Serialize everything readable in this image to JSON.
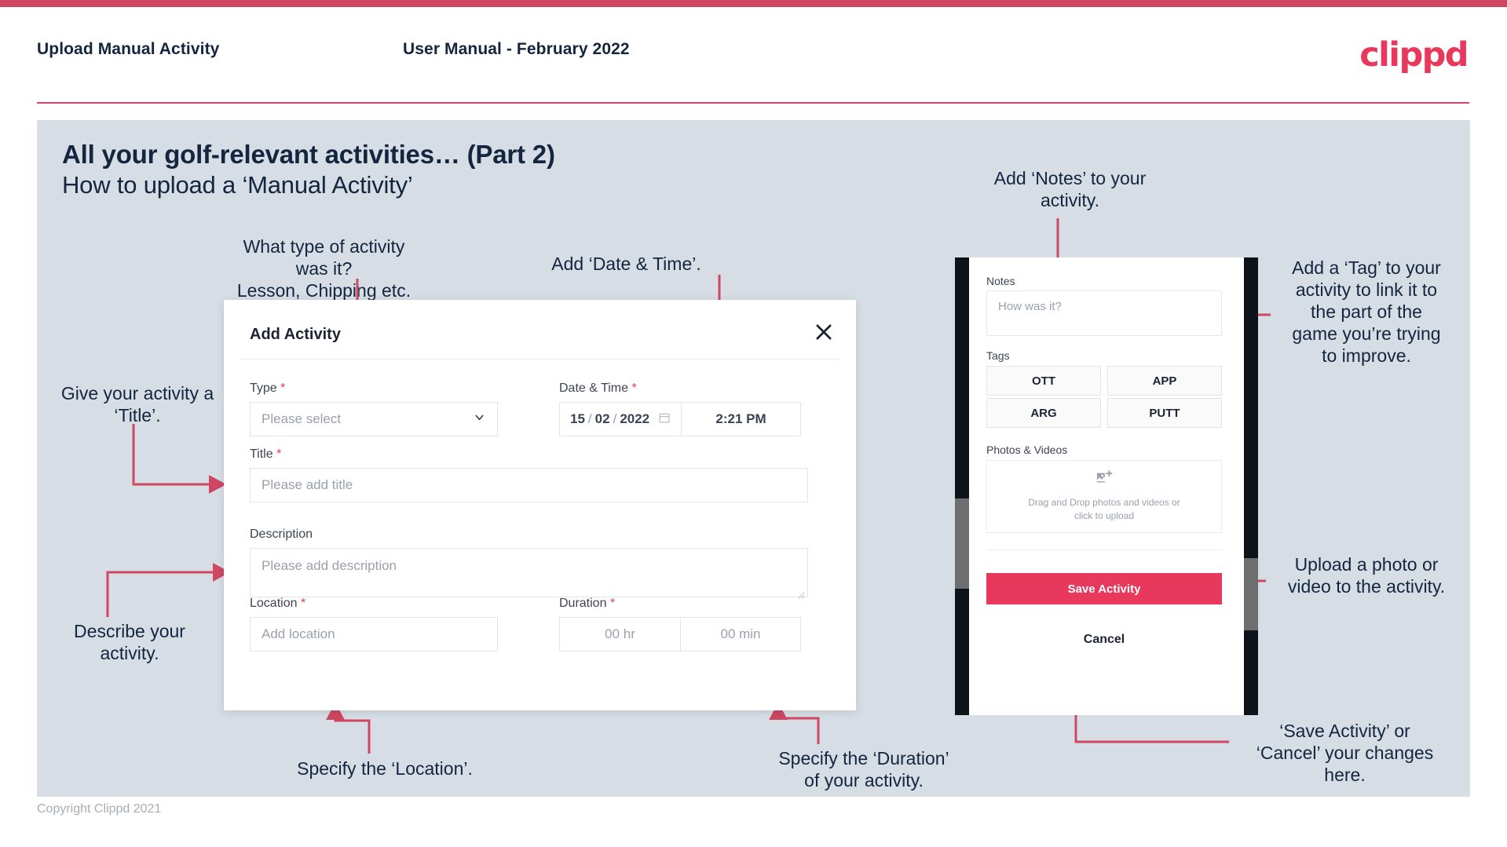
{
  "header": {
    "left_title": "Upload Manual Activity",
    "center_title": "User Manual - February 2022",
    "logo": "clippd"
  },
  "slide": {
    "title": "All your golf-relevant activities… (Part 2)",
    "subtitle": "How to upload a ‘Manual Activity’"
  },
  "annotations": {
    "type": "What type of activity was it?\nLesson, Chipping etc.",
    "datetime": "Add ‘Date & Time’.",
    "title": "Give your activity a\n‘Title’.",
    "description": "Describe your\nactivity.",
    "location": "Specify the ‘Location’.",
    "duration": "Specify the ‘Duration’\nof your activity.",
    "notes": "Add ‘Notes’ to your\nactivity.",
    "tags": "Add a ‘Tag’ to your\nactivity to link it to\nthe part of the\ngame you’re trying\nto improve.",
    "upload": "Upload a photo or\nvideo to the activity.",
    "save": "‘Save Activity’ or\n‘Cancel’ your changes\nhere."
  },
  "dialog": {
    "title": "Add Activity",
    "close_icon": "close-icon",
    "fields": {
      "type_label": "Type",
      "type_required": "*",
      "type_placeholder": "Please select",
      "datetime_label": "Date & Time",
      "datetime_required": "*",
      "date_day": "15",
      "date_month": "02",
      "date_year": "2022",
      "date_sep": "/",
      "time_value": "2:21 PM",
      "title_label": "Title",
      "title_required": "*",
      "title_placeholder": "Please add title",
      "description_label": "Description",
      "description_placeholder": "Please add description",
      "location_label": "Location",
      "location_required": "*",
      "location_placeholder": "Add location",
      "duration_label": "Duration",
      "duration_required": "*",
      "duration_hr_placeholder": "00 hr",
      "duration_min_placeholder": "00 min"
    }
  },
  "phone": {
    "notes_label": "Notes",
    "notes_placeholder": "How was it?",
    "tags_label": "Tags",
    "tags": [
      "OTT",
      "APP",
      "ARG",
      "PUTT"
    ],
    "photos_label": "Photos & Videos",
    "dropzone_icon": "add-image-icon",
    "dropzone_text": "Drag and Drop photos and videos or\nclick to upload",
    "save_label": "Save Activity",
    "cancel_label": "Cancel"
  },
  "footer": {
    "copyright": "Copyright Clippd 2021"
  },
  "colors": {
    "accent": "#e8395c",
    "rule": "#cf4763",
    "slide_bg": "#d7dde5",
    "text_dark": "#13253f"
  }
}
